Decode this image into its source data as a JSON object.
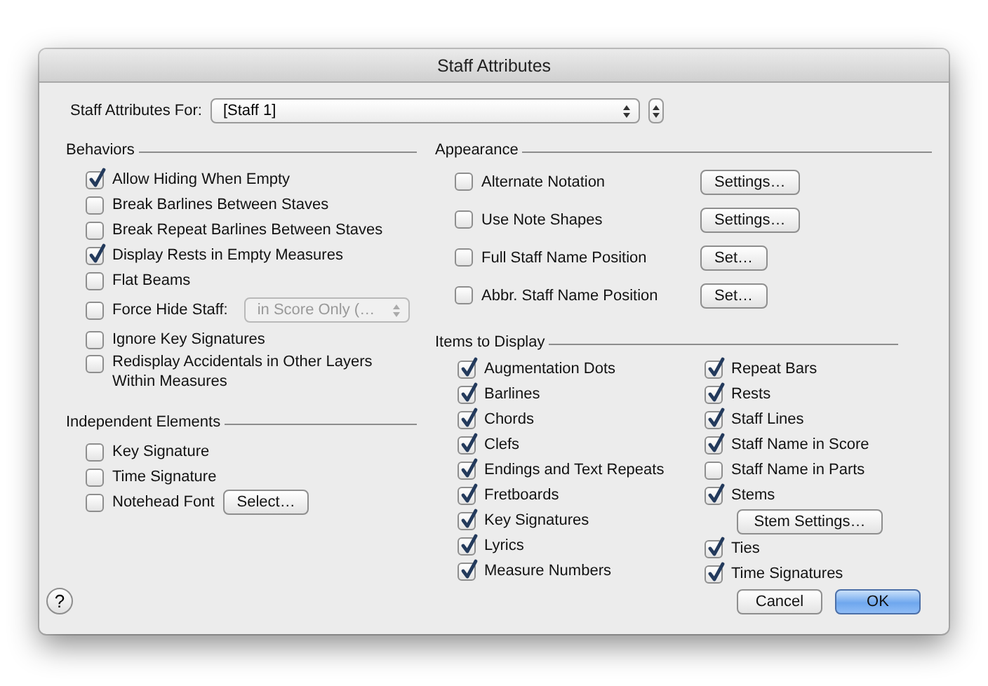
{
  "window": {
    "title": "Staff Attributes"
  },
  "staff_selector": {
    "label": "Staff Attributes For:",
    "value": "[Staff 1]"
  },
  "behaviors": {
    "title": "Behaviors",
    "items": [
      {
        "kind": "checkbox",
        "label": "Allow Hiding When Empty",
        "checked": true
      },
      {
        "kind": "checkbox",
        "label": "Break Barlines Between Staves",
        "checked": false
      },
      {
        "kind": "checkbox",
        "label": "Break Repeat Barlines Between Staves",
        "checked": false
      },
      {
        "kind": "checkbox",
        "label": "Display Rests in Empty Measures",
        "checked": true
      },
      {
        "kind": "checkbox",
        "label": "Flat Beams",
        "checked": false
      },
      {
        "kind": "checkbox_dropdown",
        "label": "Force Hide Staff:",
        "checked": false,
        "dropdown": {
          "value": "in Score Only (…",
          "disabled": true
        }
      },
      {
        "kind": "checkbox",
        "label": "Ignore Key Signatures",
        "checked": false
      },
      {
        "kind": "checkbox",
        "label": "Redisplay Accidentals in Other Layers Within Measures",
        "checked": false
      }
    ]
  },
  "independent_elements": {
    "title": "Independent Elements",
    "items": [
      {
        "kind": "checkbox",
        "label": "Key Signature",
        "checked": false
      },
      {
        "kind": "checkbox",
        "label": "Time Signature",
        "checked": false
      },
      {
        "kind": "checkbox_button",
        "label": "Notehead Font",
        "checked": false,
        "button": "Select…"
      }
    ]
  },
  "appearance": {
    "title": "Appearance",
    "items": [
      {
        "kind": "checkbox_button",
        "label": "Alternate Notation",
        "checked": false,
        "button": "Settings…"
      },
      {
        "kind": "checkbox_button",
        "label": "Use Note Shapes",
        "checked": false,
        "button": "Settings…"
      },
      {
        "kind": "checkbox_button",
        "label": "Full Staff Name Position",
        "checked": false,
        "button": "Set…"
      },
      {
        "kind": "checkbox_button",
        "label": "Abbr. Staff Name Position",
        "checked": false,
        "button": "Set…"
      }
    ]
  },
  "items_to_display": {
    "title": "Items to Display",
    "columns": [
      [
        {
          "kind": "checkbox",
          "label": "Augmentation Dots",
          "checked": true
        },
        {
          "kind": "checkbox",
          "label": "Barlines",
          "checked": true
        },
        {
          "kind": "checkbox",
          "label": "Chords",
          "checked": true
        },
        {
          "kind": "checkbox",
          "label": "Clefs",
          "checked": true
        },
        {
          "kind": "checkbox",
          "label": "Endings and Text Repeats",
          "checked": true
        },
        {
          "kind": "checkbox",
          "label": "Fretboards",
          "checked": true
        },
        {
          "kind": "checkbox",
          "label": "Key Signatures",
          "checked": true
        },
        {
          "kind": "checkbox",
          "label": "Lyrics",
          "checked": true
        },
        {
          "kind": "checkbox",
          "label": "Measure Numbers",
          "checked": true
        }
      ],
      [
        {
          "kind": "checkbox",
          "label": "Repeat Bars",
          "checked": true
        },
        {
          "kind": "checkbox",
          "label": "Rests",
          "checked": true
        },
        {
          "kind": "checkbox",
          "label": "Staff Lines",
          "checked": true
        },
        {
          "kind": "checkbox",
          "label": "Staff Name in Score",
          "checked": true
        },
        {
          "kind": "checkbox",
          "label": "Staff Name in Parts",
          "checked": false
        },
        {
          "kind": "checkbox",
          "label": "Stems",
          "checked": true
        },
        {
          "kind": "button",
          "label": "Stem Settings…"
        },
        {
          "kind": "checkbox",
          "label": "Ties",
          "checked": true
        },
        {
          "kind": "checkbox",
          "label": "Time Signatures",
          "checked": true
        }
      ]
    ]
  },
  "help_button": "?",
  "buttons": [
    {
      "label": "Cancel",
      "default": false
    },
    {
      "label": "OK",
      "default": true
    }
  ]
}
